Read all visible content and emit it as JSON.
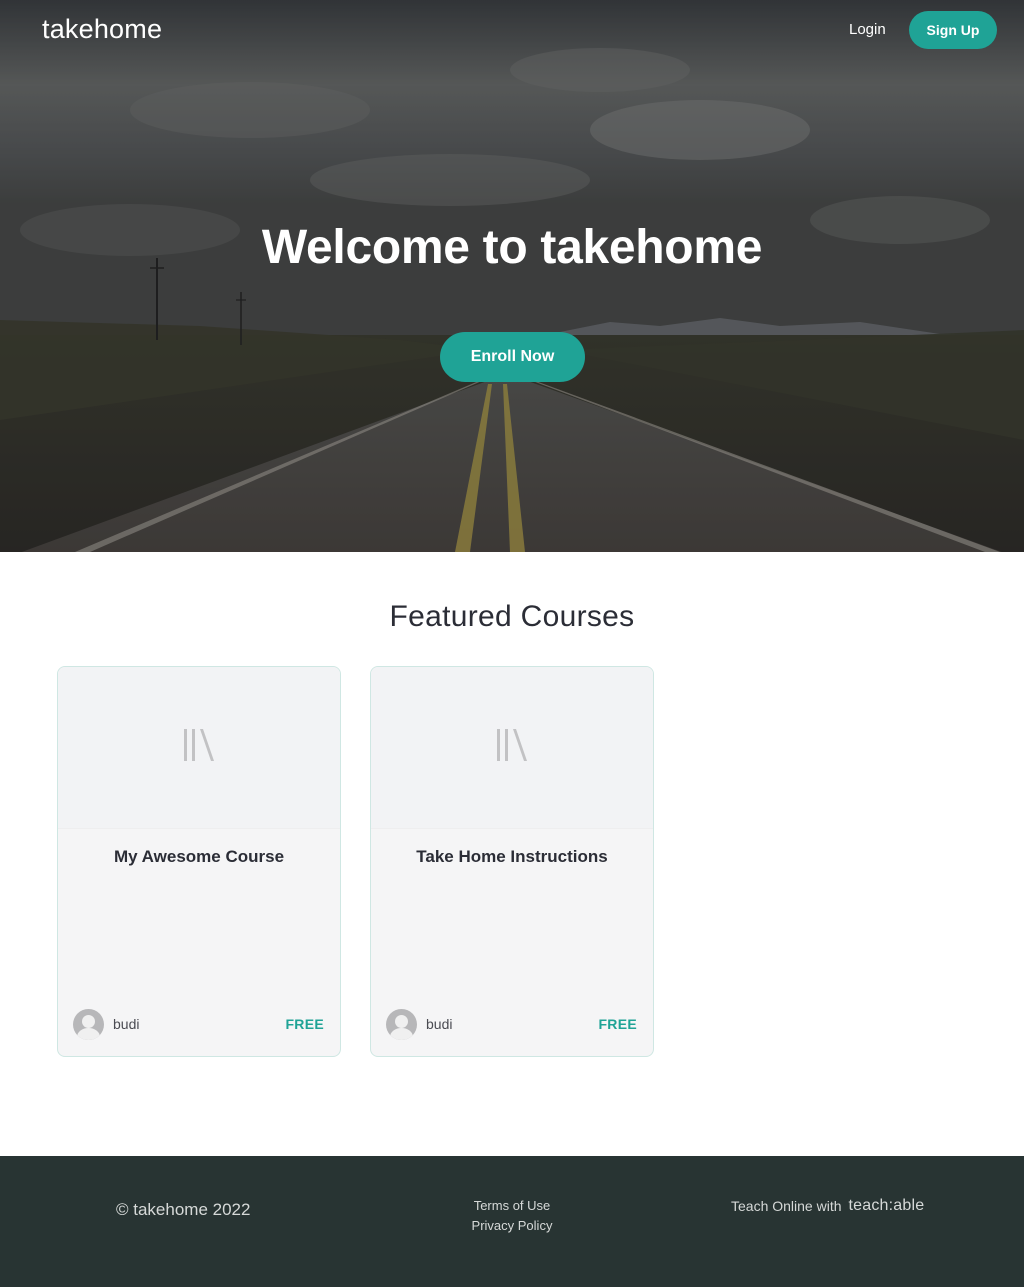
{
  "header": {
    "logo": "takehome",
    "login_label": "Login",
    "signup_label": "Sign Up"
  },
  "hero": {
    "title": "Welcome to takehome",
    "cta_label": "Enroll Now"
  },
  "featured": {
    "heading": "Featured Courses",
    "courses": [
      {
        "title": "My Awesome Course",
        "author": "budi",
        "price": "FREE",
        "thumbnail_icon": "library-icon"
      },
      {
        "title": "Take Home Instructions",
        "author": "budi",
        "price": "FREE",
        "thumbnail_icon": "library-icon"
      }
    ]
  },
  "footer": {
    "copyright": "© takehome 2022",
    "links": [
      "Terms of Use",
      "Privacy Policy"
    ],
    "teach_text": "Teach Online with",
    "teach_brand": "teach:able"
  },
  "colors": {
    "accent": "#1fa396",
    "footer_bg": "#283433",
    "card_border": "#cfe7e3"
  }
}
